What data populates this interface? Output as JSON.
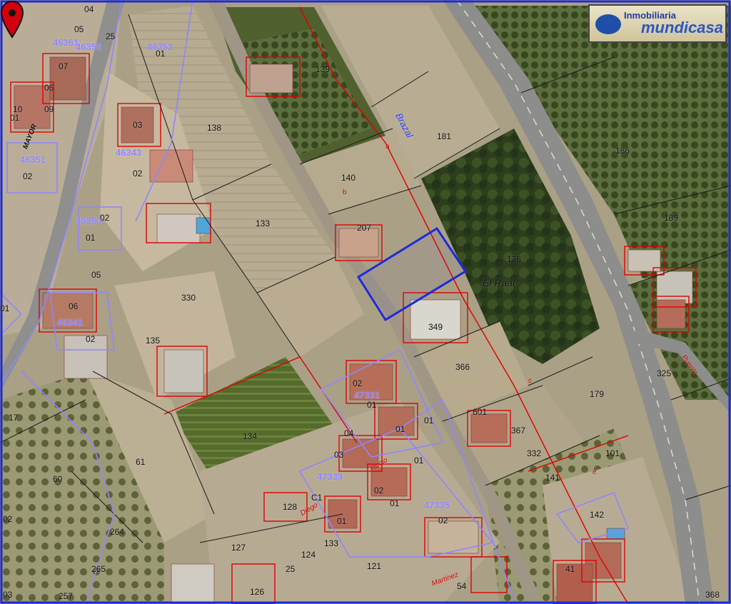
{
  "parcels": [
    "04",
    "05",
    "25",
    "46352",
    "01",
    "46361",
    "07",
    "06",
    "09",
    "10",
    "01",
    "46351",
    "02",
    "03",
    "46343",
    "02",
    "138",
    "139",
    "181",
    "140",
    "186",
    "133",
    "207",
    "189",
    "02",
    "46350",
    "01",
    "05",
    "330",
    "06",
    "46341",
    "02",
    "349",
    "135",
    "366",
    "179",
    "325",
    "02",
    "47331",
    "01",
    "01",
    "601",
    "367",
    "134",
    "61",
    "04",
    "03",
    "332",
    "01",
    "C1",
    "47339",
    "02",
    "141",
    "101",
    "02",
    "47335",
    "128",
    "01",
    "127",
    "133",
    "124",
    "121",
    "142",
    "41",
    "265",
    "264",
    "126",
    "25",
    "54",
    "368",
    "17",
    "60",
    "03",
    "257",
    "01",
    "01",
    "02",
    "01",
    "46356",
    "136",
    "a",
    "b",
    "c",
    "e"
  ],
  "parcel_ids": {
    "top_left_04": "04",
    "top_left_25": "25",
    "p46352": "46352",
    "p46361": "46361",
    "p46351": "46351",
    "p46343": "46343",
    "p46350": "46350",
    "p46341": "46341",
    "p47331": "47331",
    "p47339": "47339",
    "p47335": "47335"
  },
  "streets": {
    "brazal": "Brazal",
    "el_raal": "El Raal",
    "puente": "Puente",
    "rocio": "Rocío",
    "mayor": "MAYOR",
    "martinez": "Martínez",
    "diego": "Diego"
  },
  "logo": {
    "top": "Inmobiliaria",
    "main": "mundicasa"
  },
  "marker": {
    "icon": "map-pin-icon",
    "color": "#d4000e"
  },
  "colors": {
    "selected_parcel": "#1d2bd8",
    "cadastre_red": "#e00000",
    "cadastre_purple": "#8f86ff",
    "frame": "#1d2bd8"
  }
}
